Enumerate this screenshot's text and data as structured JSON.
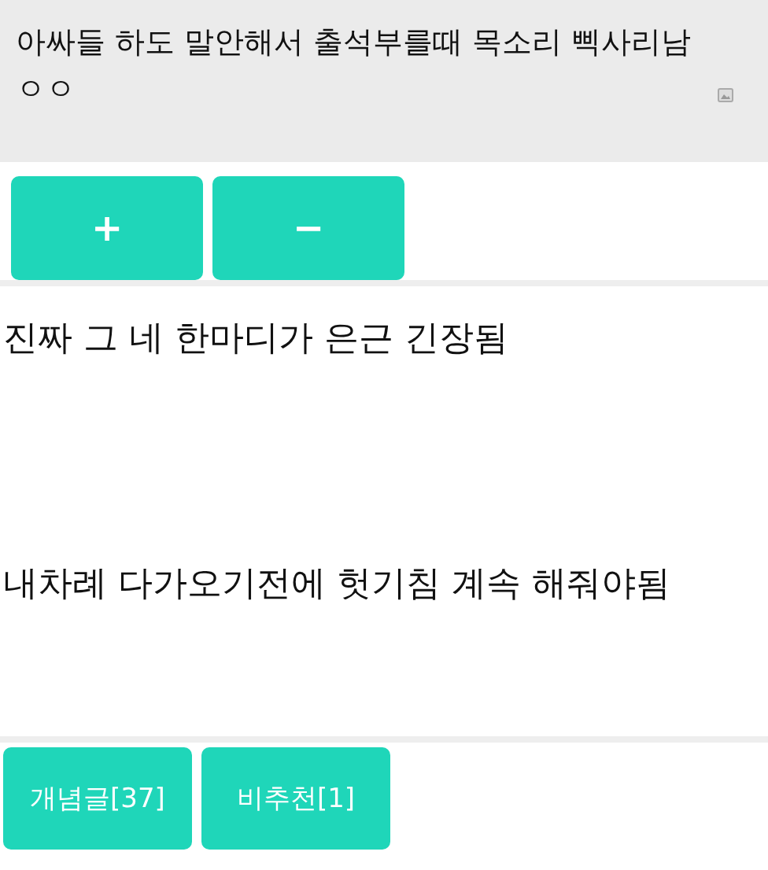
{
  "title": "아싸들 하도 말안해서 출석부를때 목소리 삑사리남 ㅇㅇ",
  "vote_buttons": [
    "+",
    "−"
  ],
  "body_lines": [
    "진짜 그 네 한마디가 은근 긴장됨",
    "내차례 다가오기전에 헛기침 계속 해줘야됨"
  ],
  "footer_buttons": [
    "개념글[37]",
    "비추천[1]"
  ]
}
